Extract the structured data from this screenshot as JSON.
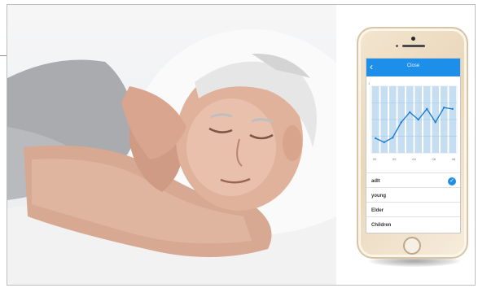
{
  "colors": {
    "accent": "#1e8fe8",
    "phone_body": "#ecdcc2",
    "chart_bar": "#c5def2",
    "chart_line": "#1e7fd0"
  },
  "phone": {
    "appbar": {
      "back_icon": "chevron-left-icon",
      "back_glyph": "‹",
      "title": "Close"
    },
    "chart_data": {
      "type": "line",
      "y_tick_top": "1",
      "x_tick_labels": [
        "00",
        "02",
        "04",
        "06",
        "08"
      ],
      "values": [
        0.22,
        0.16,
        0.23,
        0.46,
        0.61,
        0.5,
        0.66,
        0.46,
        0.68,
        0.66
      ],
      "ylim": [
        0,
        1
      ],
      "grid": true
    },
    "list_items": [
      {
        "label": "adlt",
        "selected": true
      },
      {
        "label": "young",
        "selected": false
      },
      {
        "label": "Elder",
        "selected": false
      },
      {
        "label": "Children",
        "selected": false
      }
    ],
    "check_icon": "check-icon",
    "check_glyph": "✓"
  }
}
